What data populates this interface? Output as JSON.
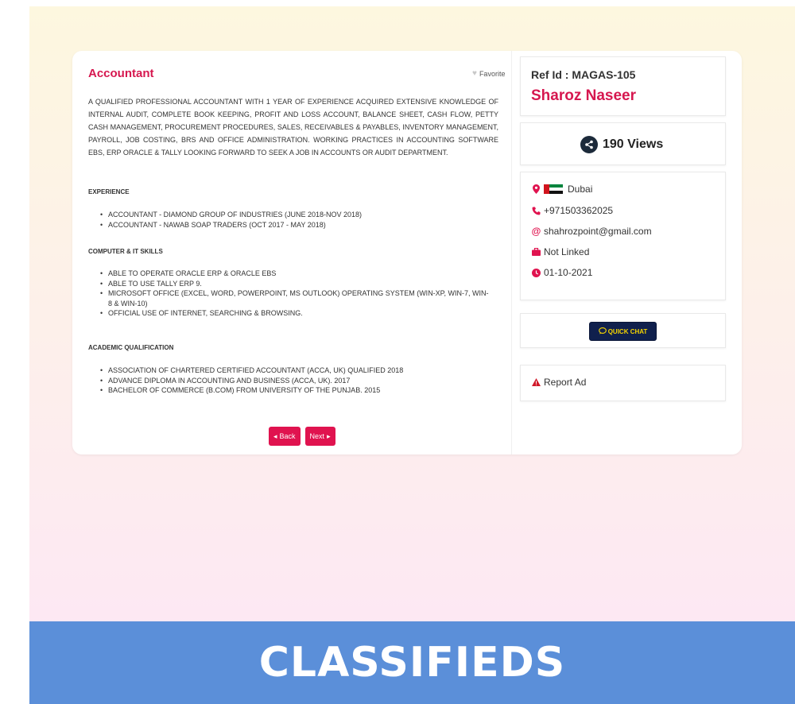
{
  "listing": {
    "job_title": "Accountant",
    "favorite_label": "Favorite",
    "summary": "A QUALIFIED PROFESSIONAL ACCOUNTANT WITH 1 YEAR OF EXPERIENCE ACQUIRED EXTENSIVE KNOWLEDGE OF INTERNAL AUDIT, COMPLETE BOOK KEEPING, PROFIT AND LOSS ACCOUNT, BALANCE SHEET, CASH FLOW, PETTY CASH MANAGEMENT, PROCUREMENT PROCEDURES, SALES, RECEIVABLES & PAYABLES, INVENTORY MANAGEMENT, PAYROLL, JOB COSTING, BRS AND OFFICE ADMINISTRATION. WORKING PRACTICES IN ACCOUNTING SOFTWARE EBS, ERP ORACLE & TALLY LOOKING FORWARD TO SEEK A JOB IN ACCOUNTS OR AUDIT DEPARTMENT.",
    "sections": [
      {
        "heading": "EXPERIENCE",
        "items": [
          "ACCOUNTANT - DIAMOND GROUP OF INDUSTRIES (JUNE 2018-NOV 2018)",
          "ACCOUNTANT - NAWAB SOAP TRADERS (OCT 2017 - MAY 2018)"
        ]
      },
      {
        "heading": "COMPUTER & IT SKILLS",
        "items": [
          "ABLE TO OPERATE ORACLE ERP & ORACLE EBS",
          "ABLE TO USE TALLY ERP 9.",
          "MICROSOFT OFFICE (EXCEL, WORD, POWERPOINT, MS OUTLOOK) OPERATING SYSTEM (WIN-XP, WIN-7, WIN-8 & WIN-10)",
          "OFFICIAL USE OF INTERNET, SEARCHING & BROWSING."
        ]
      },
      {
        "heading": "ACADEMIC QUALIFICATION",
        "items": [
          "ASSOCIATION OF CHARTERED CERTIFIED ACCOUNTANT (ACCA, UK) QUALIFIED 2018",
          "ADVANCE DIPLOMA IN ACCOUNTING AND BUSINESS (ACCA, UK). 2017",
          "BACHELOR OF COMMERCE (B.COM) FROM UNIVERSITY OF THE PUNJAB. 2015"
        ]
      }
    ],
    "back_label": "Back",
    "next_label": "Next"
  },
  "sidebar": {
    "ref_id": "Ref Id : MAGAS-105",
    "person_name": "Sharoz Naseer",
    "views": "190 Views",
    "location": "Dubai",
    "phone": "+971503362025",
    "email": "shahrozpoint@gmail.com",
    "company": "Not Linked",
    "date": "01-10-2021",
    "quick_chat_label": "QUICK CHAT",
    "report_label": "Report Ad"
  },
  "banner": {
    "title": "CLASSIFIEDS"
  },
  "colors": {
    "accent": "#e0134f",
    "title_red": "#d6174f",
    "navy": "#10204d",
    "banner": "#5b8fd9"
  },
  "icons": [
    "heart-icon",
    "caret-left-icon",
    "caret-right-icon",
    "share-icon",
    "map-marker-icon",
    "uae-flag-icon",
    "phone-icon",
    "at-icon",
    "briefcase-icon",
    "clock-icon",
    "chat-icon",
    "warning-icon"
  ]
}
